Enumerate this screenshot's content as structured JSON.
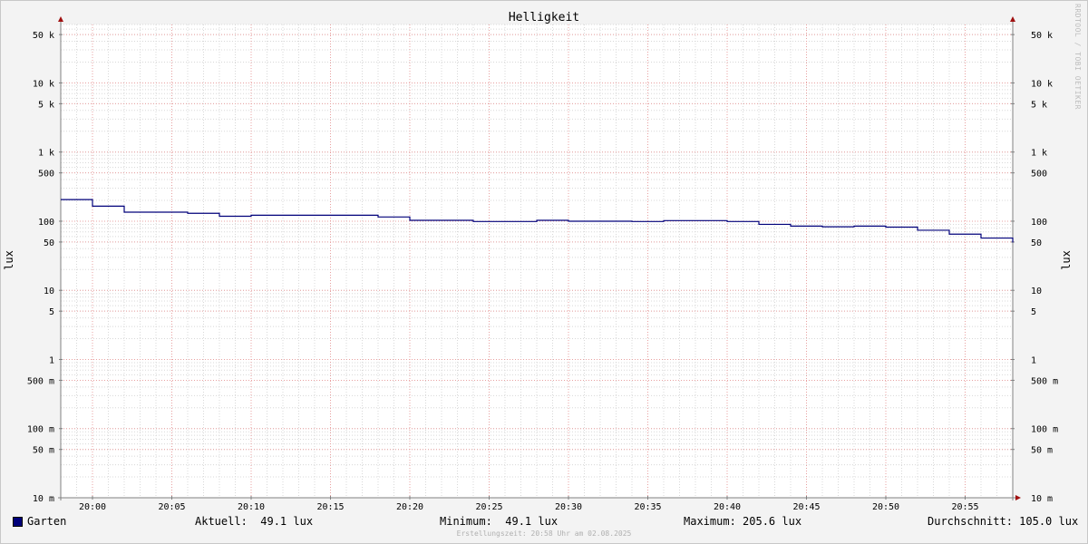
{
  "chart_data": {
    "type": "line",
    "title": "Helligkeit",
    "ylabel": "lux",
    "ylabel_right": "lux",
    "y_scale": "log",
    "ylim": [
      0.01,
      70000
    ],
    "xlim": [
      "19:58",
      "20:58"
    ],
    "y_ticks": [
      {
        "value": 50000,
        "label": "50 k"
      },
      {
        "value": 10000,
        "label": "10 k"
      },
      {
        "value": 5000,
        "label": "5 k"
      },
      {
        "value": 1000,
        "label": "1 k"
      },
      {
        "value": 500,
        "label": "500"
      },
      {
        "value": 100,
        "label": "100"
      },
      {
        "value": 50,
        "label": "50"
      },
      {
        "value": 10,
        "label": "10"
      },
      {
        "value": 5,
        "label": "5"
      },
      {
        "value": 1,
        "label": "1"
      },
      {
        "value": 0.5,
        "label": "500 m"
      },
      {
        "value": 0.1,
        "label": "100 m"
      },
      {
        "value": 0.05,
        "label": "50 m"
      },
      {
        "value": 0.01,
        "label": "10 m"
      }
    ],
    "x_ticks": [
      "20:00",
      "20:05",
      "20:10",
      "20:15",
      "20:20",
      "20:25",
      "20:30",
      "20:35",
      "20:40",
      "20:45",
      "20:50",
      "20:55"
    ],
    "grid": true,
    "series": [
      {
        "name": "Garten",
        "color": "#00007a",
        "step": true,
        "x": [
          "19:58",
          "20:00",
          "20:02",
          "20:06",
          "20:08",
          "20:10",
          "20:18",
          "20:20",
          "20:24",
          "20:28",
          "20:30",
          "20:34",
          "20:36",
          "20:40",
          "20:42",
          "20:44",
          "20:46",
          "20:48",
          "20:50",
          "20:52",
          "20:54",
          "20:56",
          "20:58"
        ],
        "y": [
          205.6,
          165,
          135,
          130,
          118,
          122,
          115,
          103,
          99,
          103,
          100,
          99,
          102,
          99,
          90,
          85,
          83,
          85,
          82,
          74,
          65,
          57,
          49.1
        ]
      }
    ]
  },
  "legend": {
    "series_name": "Garten",
    "aktuell": "Aktuell:  49.1 lux",
    "minimum": "Minimum:  49.1 lux",
    "maximum": "Maximum: 205.6 lux",
    "durchschnitt": "Durchschnitt: 105.0 lux"
  },
  "footer": "Erstellungszeit: 20:58 Uhr am 02.08.2025",
  "watermark": "RRDTOOL / TOBI OETIKER",
  "colors": {
    "background": "#f3f3f3",
    "plot_background": "#ffffff",
    "major_grid": "#e8a0a0",
    "minor_grid": "#d8d8d8",
    "axis": "#808080",
    "arrow": "#a01010",
    "series": "#00007a"
  }
}
